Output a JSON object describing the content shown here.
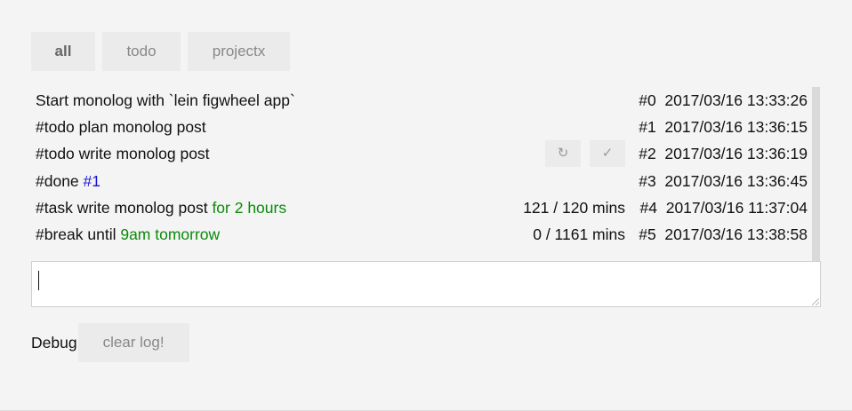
{
  "tabs": [
    "all",
    "todo",
    "projectx"
  ],
  "log": [
    {
      "text": "Start monolog with `lein figwheel app`",
      "extra": "",
      "extra_color": "",
      "duration": "",
      "id": "#0",
      "timestamp": "2017/03/16 13:33:26"
    },
    {
      "text": "#todo plan monolog post",
      "extra": "",
      "extra_color": "",
      "duration": "",
      "id": "#1",
      "timestamp": "2017/03/16 13:36:15"
    },
    {
      "text": "#todo write monolog post",
      "extra": "",
      "extra_color": "",
      "duration": "",
      "id": "#2",
      "timestamp": "2017/03/16 13:36:19",
      "actions": [
        "↻",
        "✓"
      ]
    },
    {
      "text": "#done ",
      "extra": "#1",
      "extra_color": "#1414d2",
      "duration": "",
      "id": "#3",
      "timestamp": "2017/03/16 13:36:45"
    },
    {
      "text": "#task write monolog post ",
      "extra": "for 2 hours",
      "extra_color": "#0a8a0a",
      "duration": "121 / 120 mins",
      "id": "#4",
      "timestamp": "2017/03/16 11:37:04"
    },
    {
      "text": "#break until ",
      "extra": "9am tomorrow",
      "extra_color": "#0a8a0a",
      "duration": "0 / 1161 mins",
      "id": "#5",
      "timestamp": "2017/03/16 13:38:58"
    }
  ],
  "input": {
    "value": ""
  },
  "debug": {
    "label": "Debug",
    "clear_label": "clear log!"
  }
}
